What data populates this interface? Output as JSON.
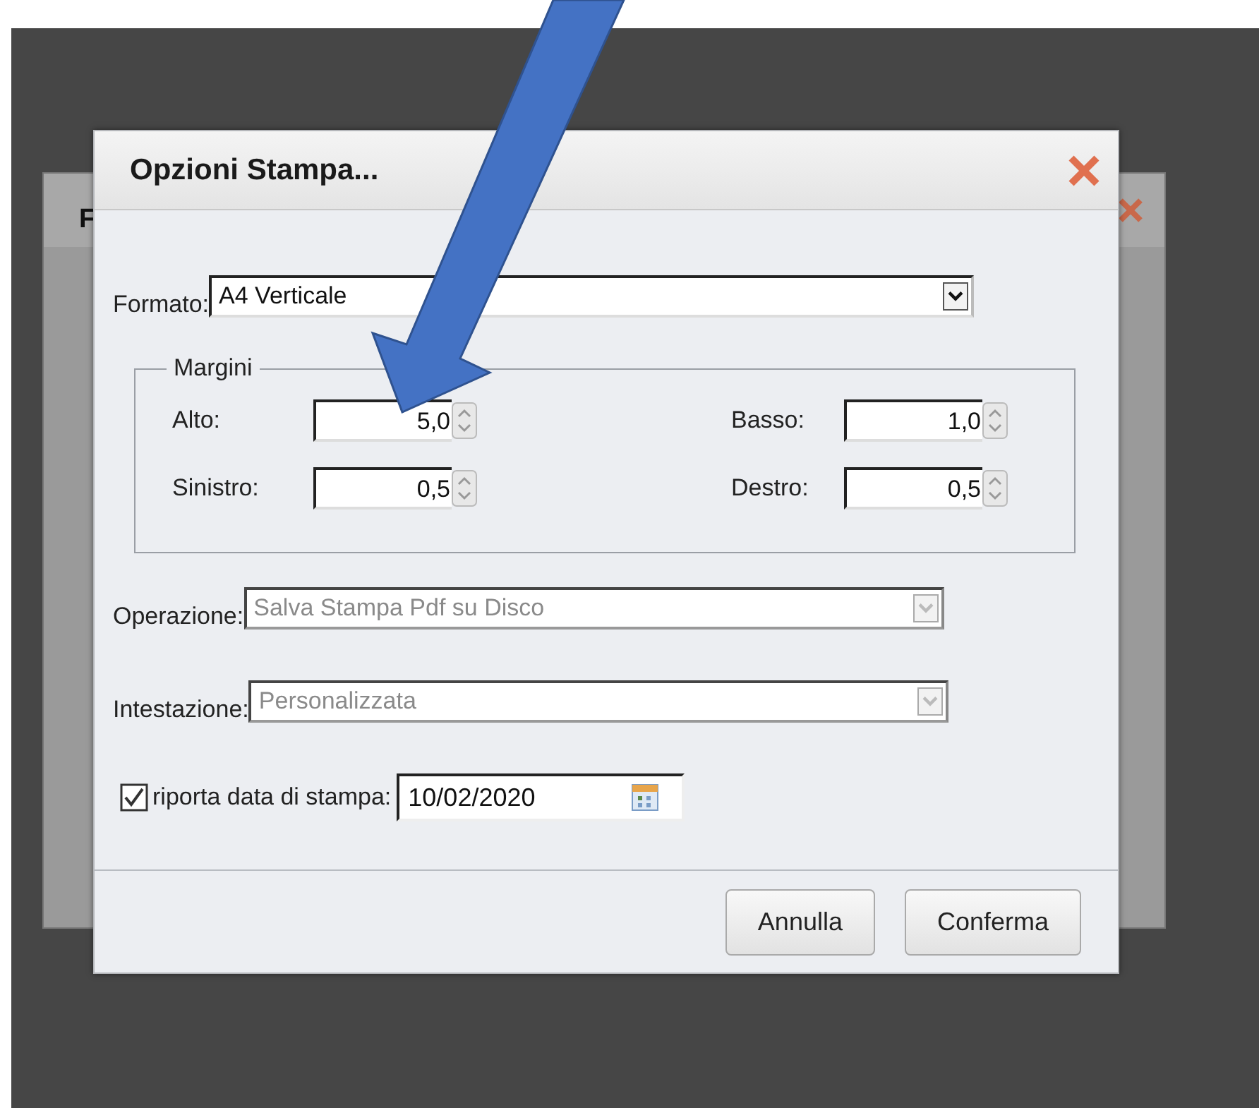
{
  "background_window": {
    "title": "F"
  },
  "dialog": {
    "title": "Opzioni Stampa...",
    "format": {
      "label": "Formato:",
      "value": "A4 Verticale"
    },
    "margins": {
      "legend": "Margini",
      "fields": [
        {
          "label": "Alto:",
          "value": "5,0"
        },
        {
          "label": "Basso:",
          "value": "1,0"
        },
        {
          "label": "Sinistro:",
          "value": "0,5"
        },
        {
          "label": "Destro:",
          "value": "0,5"
        }
      ]
    },
    "selects": [
      {
        "label": "Operazione:",
        "value": "Salva Stampa Pdf su Disco",
        "disabled": true
      },
      {
        "label": "Intestazione:",
        "value": "Personalizzata",
        "disabled": true
      }
    ],
    "print_date": {
      "label": "riporta data di stampa:",
      "checked": true,
      "value": "10/02/2020"
    },
    "buttons": [
      "Annulla",
      "Conferma"
    ]
  }
}
